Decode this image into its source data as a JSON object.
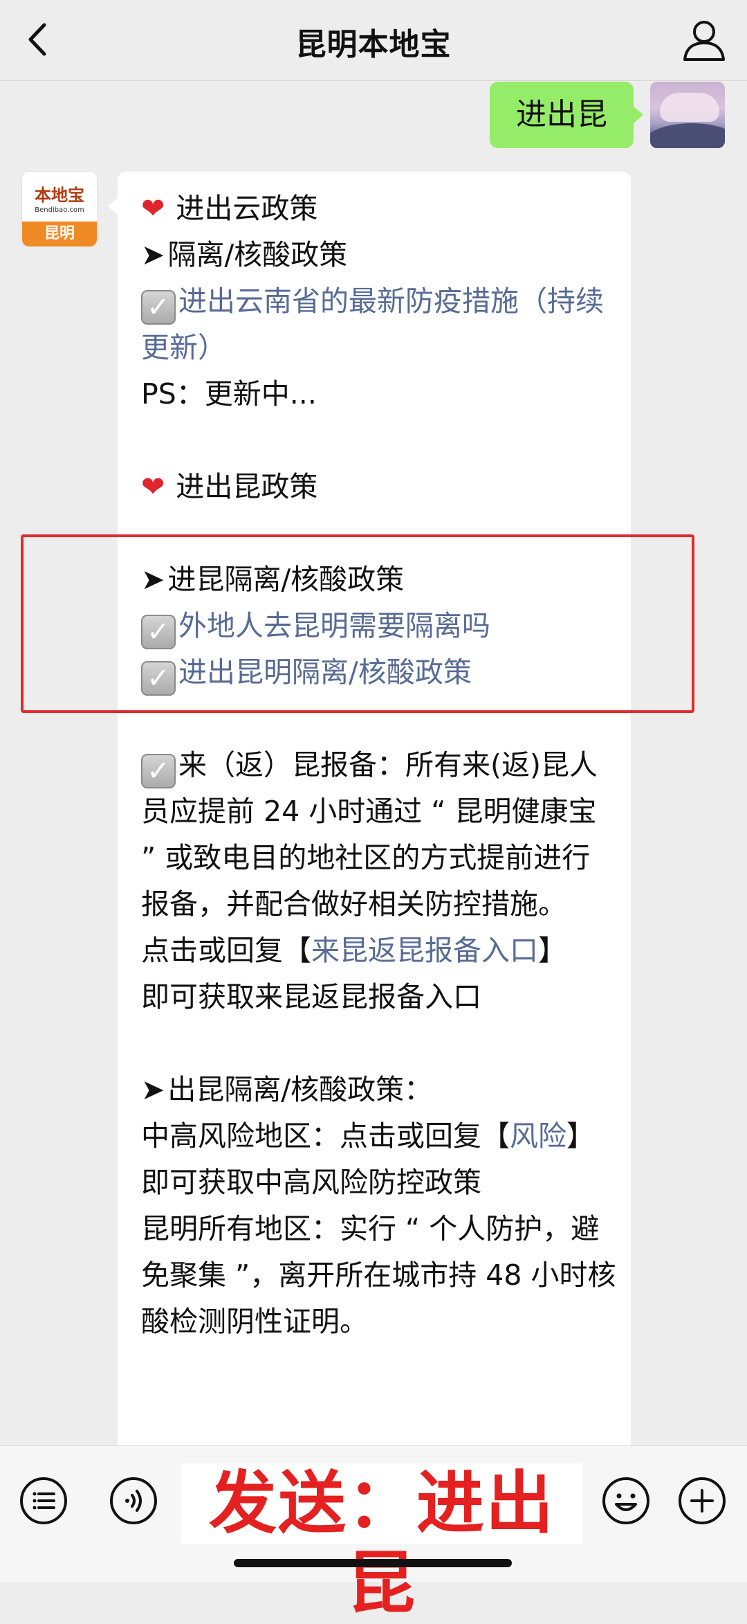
{
  "header": {
    "title": "昆明本地宝",
    "back_icon": "chevron-left-icon",
    "profile_icon": "person-icon"
  },
  "outgoing": {
    "text": "进出昆"
  },
  "bot": {
    "logo_top": "本地宝",
    "logo_url": "Bendibao.com",
    "logo_band": "昆明"
  },
  "message": {
    "h1": "进出云政策",
    "h2": "隔离/核酸政策",
    "link1": "进出云南省的最新防疫措施（持续更新）",
    "ps": "PS：更新中...",
    "h3": "进出昆政策",
    "h4": "进昆隔离/核酸政策",
    "link2": "外地人去昆明需要隔离吗",
    "link3": "进出昆明隔离/核酸政策",
    "para1": "来（返）昆报备：所有来(返)昆人员应提前 24 小时通过 “ 昆明健康宝 ” 或致电目的地社区的方式提前进行报备，并配合做好相关防控措施。",
    "reply1_prefix": "点击或回复【",
    "reply1_link": "来昆返昆报备入口",
    "reply1_suffix": "】",
    "reply1_tail": "即可获取来昆返昆报备入口",
    "h5": "出昆隔离/核酸政策：",
    "risk_prefix": "中高风险地区：点击或回复【",
    "risk_link": "风险",
    "risk_suffix": "】",
    "risk_tail": "即可获取中高风险防控政策",
    "all_areas": "昆明所有地区：实行 “ 个人防护，避免聚集 ”，离开所在城市持 48 小时核酸检测阴性证明。"
  },
  "bottom": {
    "menu_icon": "menu-list-icon",
    "voice_icon": "voice-icon",
    "emoji_icon": "emoji-icon",
    "plus_icon": "plus-icon",
    "send_text": "发送：进出昆"
  },
  "colors": {
    "background": "#ededed",
    "outgoing_bubble": "#95ec69",
    "link": "#576b95",
    "highlight": "#e12b2b",
    "send_text": "#e42020"
  }
}
